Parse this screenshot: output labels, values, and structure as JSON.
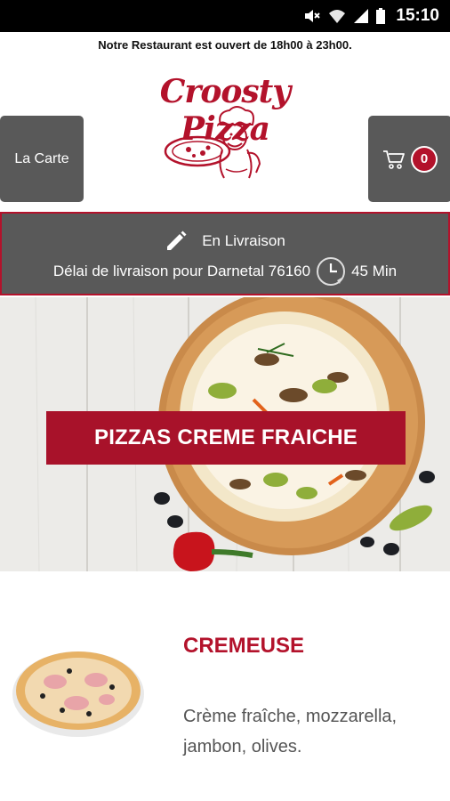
{
  "status_bar": {
    "time": "15:10",
    "icons": [
      "mute-icon",
      "wifi-icon",
      "signal-icon",
      "battery-icon"
    ]
  },
  "notice": {
    "text": "Notre Restaurant est ouvert de 18h00 à 23h00."
  },
  "header": {
    "logo_text": "Croosty Pizza",
    "menu_button_label": "La Carte",
    "cart_count": "0",
    "cart_icon": "shopping-cart-icon"
  },
  "delivery": {
    "mode_icon": "pencil-icon",
    "mode": "En Livraison",
    "delay_text": "Délai de livraison pour Darnetal 76160",
    "clock_icon": "clock-icon",
    "delay_value": "45 Min"
  },
  "category": {
    "title": "PIZZAS CREME FRAICHE"
  },
  "product": {
    "name": "CREMEUSE",
    "description": "Crème fraîche, mozzarella, jambon, olives."
  },
  "colors": {
    "brand": "#b3122b",
    "panel": "#595959",
    "status_bar": "#000000"
  }
}
